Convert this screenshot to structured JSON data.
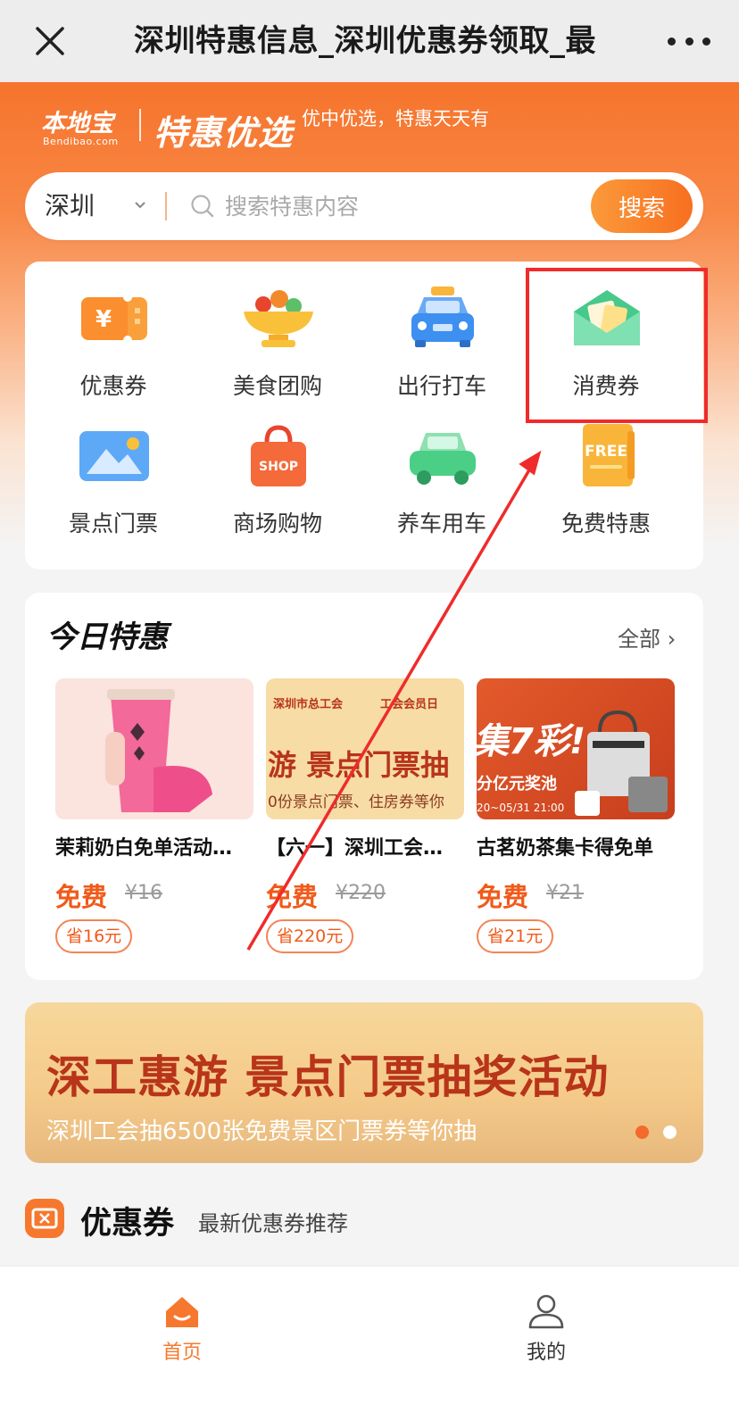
{
  "nav": {
    "title": "深圳特惠信息_深圳优惠券领取_最",
    "close_icon": "close-icon",
    "more_icon": "more-icon"
  },
  "header": {
    "logo_text": "本地宝",
    "logo_sub": "Bendibao.com",
    "brand": "特惠优选",
    "slogan": "优中优选，特惠天天有"
  },
  "search": {
    "city": "深圳",
    "placeholder": "搜索特惠内容",
    "button": "搜索"
  },
  "categories": [
    {
      "label": "优惠券",
      "icon": "coupon-icon"
    },
    {
      "label": "美食团购",
      "icon": "food-bowl-icon"
    },
    {
      "label": "出行打车",
      "icon": "taxi-icon"
    },
    {
      "label": "消费券",
      "icon": "envelope-icon"
    },
    {
      "label": "景点门票",
      "icon": "scenic-ticket-icon"
    },
    {
      "label": "商场购物",
      "icon": "shopping-bag-icon"
    },
    {
      "label": "养车用车",
      "icon": "car-icon"
    },
    {
      "label": "免费特惠",
      "icon": "free-icon"
    }
  ],
  "deals": {
    "title": "今日特惠",
    "all_link": "全部",
    "items": [
      {
        "title": "茉莉奶白免单活动…",
        "price": "免费",
        "original": "¥16",
        "save": "省16元"
      },
      {
        "title": "【六一】深圳工会…",
        "price": "免费",
        "original": "¥220",
        "save": "省220元",
        "img_text_1": "深圳市总工会",
        "img_text_2": "工会会员日",
        "img_text_3": "游 景点门票抽",
        "img_text_4": "0份景点门票、住房券等你"
      },
      {
        "title": "古茗奶茶集卡得免单",
        "price": "免费",
        "original": "¥21",
        "save": "省21元",
        "img_text_1": "集7彩!",
        "img_text_2": "分亿元奖池",
        "img_text_3": "20~05/31 21:00"
      }
    ]
  },
  "banner": {
    "title": "深工惠游 景点门票抽奖活动",
    "subtitle": "深圳工会抽6500张免费景区门票券等你抽"
  },
  "coupon_section": {
    "title": "优惠券",
    "subtitle": "最新优惠券推荐"
  },
  "tabs": [
    {
      "label": "首页",
      "icon": "home-icon",
      "active": true
    },
    {
      "label": "我的",
      "icon": "user-icon",
      "active": false
    }
  ],
  "colors": {
    "accent": "#f86f20",
    "price": "#f05a1a",
    "annotation": "#ef2b2b"
  }
}
